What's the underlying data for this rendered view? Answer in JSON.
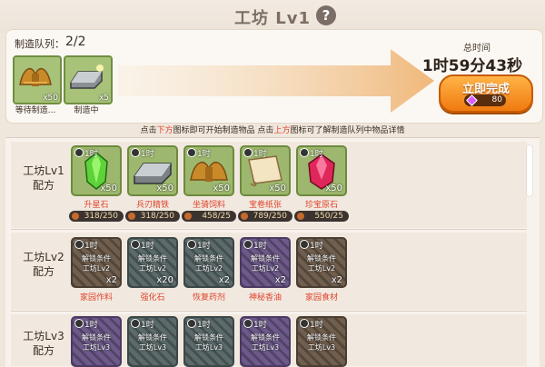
{
  "header": {
    "title": "工坊 Lv1",
    "help_icon": "?"
  },
  "queue": {
    "label": "制造队列：",
    "count": "2/2",
    "slots": [
      {
        "icon": "wool-bundle-icon",
        "qty": "x50",
        "status": "等待制造..."
      },
      {
        "icon": "iron-ingot-icon",
        "qty": "x5",
        "status": "制造中"
      }
    ]
  },
  "total": {
    "label": "总时间",
    "time": "1时59分43秒"
  },
  "finish_button": {
    "label": "立即完成",
    "cost": "80"
  },
  "hint": {
    "part1": "点击",
    "red1": "下方",
    "part2": "图标即可开始制造物品 点击",
    "red2": "上方",
    "part3": "图标可了解制造队列中物品详情"
  },
  "rows": [
    {
      "title_line1": "工坊Lv1",
      "title_line2": "配方",
      "items": [
        {
          "icon": "green-gem-icon",
          "time": "1时",
          "qty": "x50",
          "name": "升星石",
          "cost": "318/250"
        },
        {
          "icon": "iron-ingot-icon",
          "time": "1时",
          "qty": "x50",
          "name": "兵刃精铁",
          "cost": "318/250"
        },
        {
          "icon": "wool-bundle-icon",
          "time": "1时",
          "qty": "x50",
          "name": "坐骑饲料",
          "cost": "458/25"
        },
        {
          "icon": "scroll-icon",
          "time": "1时",
          "qty": "x50",
          "name": "宝卷纸张",
          "cost": "789/250"
        },
        {
          "icon": "red-gem-icon",
          "time": "1时",
          "qty": "x50",
          "name": "珍宝原石",
          "cost": "550/25"
        }
      ]
    },
    {
      "title_line1": "工坊Lv2",
      "title_line2": "配方",
      "items": [
        {
          "time": "1时",
          "cond1": "解锁条件",
          "cond2": "工坊Lv2",
          "qty": "x2",
          "name": "家园作料"
        },
        {
          "time": "1时",
          "cond1": "解锁条件",
          "cond2": "工坊Lv2",
          "qty": "x20",
          "name": "强化石"
        },
        {
          "time": "1时",
          "cond1": "解锁条件",
          "cond2": "工坊Lv2",
          "qty": "x2",
          "name": "恢复药剂"
        },
        {
          "time": "1时",
          "cond1": "解锁条件",
          "cond2": "工坊Lv2",
          "qty": "x2",
          "name": "神秘香油"
        },
        {
          "time": "1时",
          "cond1": "解锁条件",
          "cond2": "工坊Lv2",
          "qty": "x2",
          "name": "家园食材"
        }
      ]
    },
    {
      "title_line1": "工坊Lv3",
      "title_line2": "配方",
      "items": [
        {
          "time": "1时",
          "cond1": "解锁条件",
          "cond2": "工坊Lv3"
        },
        {
          "time": "1时",
          "cond1": "解锁条件",
          "cond2": "工坊Lv3"
        },
        {
          "time": "1时",
          "cond1": "解锁条件",
          "cond2": "工坊Lv3"
        },
        {
          "time": "1时",
          "cond1": "解锁条件",
          "cond2": "工坊Lv3"
        },
        {
          "time": "1时",
          "cond1": "解锁条件",
          "cond2": "工坊Lv3"
        }
      ]
    }
  ]
}
